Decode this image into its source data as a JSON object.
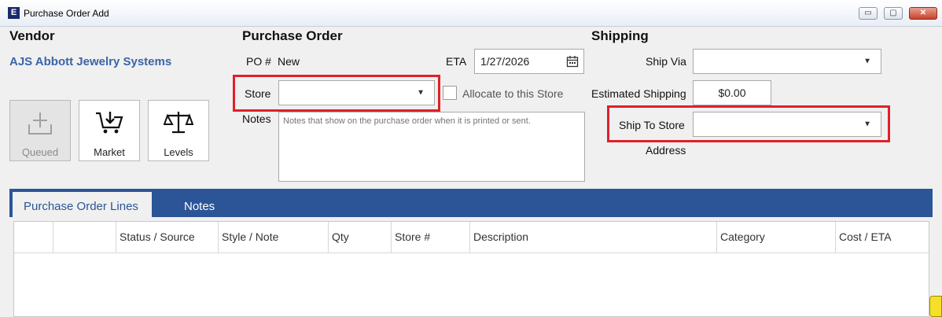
{
  "window": {
    "title": "Purchase Order Add",
    "icon_letter": "E",
    "controls": {
      "minimize": "▭",
      "maximize": "▢",
      "close": "✕"
    }
  },
  "vendor": {
    "heading": "Vendor",
    "name": "AJS Abbott Jewelry Systems",
    "buttons": [
      {
        "label": "Queued",
        "icon": "inbox-add-icon",
        "enabled": false
      },
      {
        "label": "Market",
        "icon": "cart-download-icon",
        "enabled": true
      },
      {
        "label": "Levels",
        "icon": "scale-icon",
        "enabled": true
      }
    ]
  },
  "purchase_order": {
    "heading": "Purchase Order",
    "po_label": "PO #",
    "po_value": "New",
    "eta_label": "ETA",
    "eta_value": "1/27/2026",
    "store_label": "Store",
    "store_value": "",
    "allocate_label": "Allocate to this Store",
    "notes_label": "Notes",
    "notes_placeholder": "Notes that show on the purchase order when it is printed or sent."
  },
  "shipping": {
    "heading": "Shipping",
    "ship_via_label": "Ship Via",
    "ship_via_value": "",
    "estimated_label": "Estimated Shipping",
    "estimated_value": "$0.00",
    "ship_to_label": "Ship To Store",
    "ship_to_value": "",
    "address_label": "Address"
  },
  "tabs": [
    {
      "label": "Purchase Order Lines",
      "active": true
    },
    {
      "label": "Notes",
      "active": false
    }
  ],
  "grid": {
    "columns": [
      "",
      "",
      "Status / Source",
      "Style / Note",
      "Qty",
      "Store #",
      "Description",
      "Category",
      "Cost / ETA"
    ],
    "rows": []
  },
  "colors": {
    "accent": "#2b5597",
    "vendor_link": "#3a64a8",
    "highlight": "#e0202a"
  }
}
